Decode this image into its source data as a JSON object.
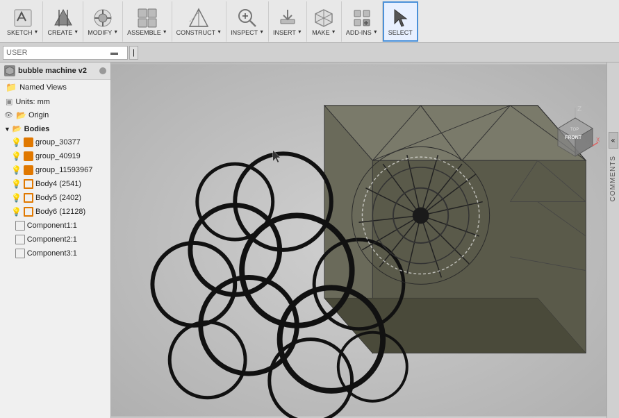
{
  "toolbar": {
    "groups": [
      {
        "id": "sketch",
        "label": "SKETCH",
        "has_arrow": true,
        "icon": "✏"
      },
      {
        "id": "create",
        "label": "CREATE",
        "has_arrow": true,
        "icon": "◆"
      },
      {
        "id": "modify",
        "label": "MODIFY",
        "has_arrow": true,
        "icon": "⬡"
      },
      {
        "id": "assemble",
        "label": "ASSEMBLE",
        "has_arrow": true,
        "icon": "⧉"
      },
      {
        "id": "construct",
        "label": "CONSTRUCT",
        "has_arrow": true,
        "icon": "△"
      },
      {
        "id": "inspect",
        "label": "INSPECT",
        "has_arrow": true,
        "icon": "🔍"
      },
      {
        "id": "insert",
        "label": "INSERT",
        "has_arrow": true,
        "icon": "⤓"
      },
      {
        "id": "make",
        "label": "MAKE",
        "has_arrow": true,
        "icon": "⚙"
      },
      {
        "id": "add-ins",
        "label": "ADD-INS",
        "has_arrow": true,
        "icon": "⊞"
      },
      {
        "id": "select",
        "label": "SELECT",
        "has_arrow": false,
        "icon": "↖"
      }
    ]
  },
  "second_bar": {
    "search_placeholder": "USER",
    "search_value": ""
  },
  "sidebar": {
    "project": {
      "name": "bubble machine v2",
      "icon": "◈"
    },
    "items": [
      {
        "id": "named-views",
        "label": "Named Views",
        "type": "named-views",
        "indent": 1
      },
      {
        "id": "units",
        "label": "Units: mm",
        "type": "units",
        "indent": 1
      },
      {
        "id": "origin",
        "label": "Origin",
        "type": "folder",
        "indent": 1
      },
      {
        "id": "bodies",
        "label": "Bodies",
        "type": "section",
        "indent": 1
      },
      {
        "id": "group_30377",
        "label": "group_30377",
        "type": "body-orange",
        "indent": 2
      },
      {
        "id": "group_40919",
        "label": "group_40919",
        "type": "body-orange",
        "indent": 2
      },
      {
        "id": "group_11593967",
        "label": "group_11593967",
        "type": "body-orange",
        "indent": 2
      },
      {
        "id": "body4",
        "label": "Body4 (2541)",
        "type": "body-outline",
        "indent": 2
      },
      {
        "id": "body5",
        "label": "Body5 (2402)",
        "type": "body-outline",
        "indent": 2
      },
      {
        "id": "body6",
        "label": "Body6 (12128)",
        "type": "body-outline",
        "indent": 2
      },
      {
        "id": "component1",
        "label": "Component1:1",
        "type": "component",
        "indent": 1
      },
      {
        "id": "component2",
        "label": "Component2:1",
        "type": "component",
        "indent": 1
      },
      {
        "id": "component3",
        "label": "Component3:1",
        "type": "component",
        "indent": 1
      }
    ]
  },
  "viewport": {
    "nav_cube": {
      "front_label": "FRONT",
      "top_label": "TOP"
    }
  },
  "comments": {
    "label": "COMMENTS"
  }
}
